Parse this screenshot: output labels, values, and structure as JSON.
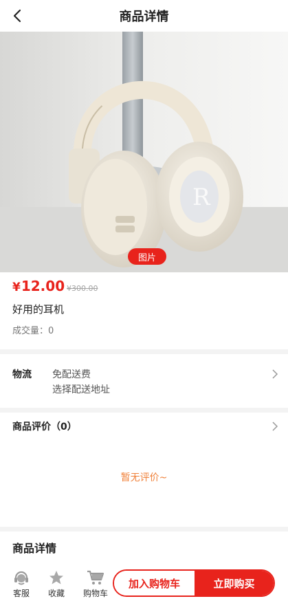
{
  "header": {
    "title": "商品详情"
  },
  "gallery": {
    "tag": "图片"
  },
  "product": {
    "currency": "¥",
    "price": "12.00",
    "original_price": "¥300.00",
    "name": "好用的耳机",
    "sold": "成交量：0"
  },
  "shipping": {
    "label": "物流",
    "line1": "免配送费",
    "line2": "选择配送地址"
  },
  "reviews": {
    "title": "商品评价（0）",
    "empty": "暂无评价~"
  },
  "details": {
    "title": "商品详情"
  },
  "bottom": {
    "service": "客服",
    "favorite": "收藏",
    "cart": "购物车",
    "add_to_cart": "加入购物车",
    "buy_now": "立即购买"
  },
  "icons": {
    "back": "back-arrow-icon",
    "chevron": "chevron-right-icon",
    "service": "headset-icon",
    "favorite": "star-icon",
    "cart": "cart-icon"
  },
  "colors": {
    "accent": "#e8231c",
    "empty_text": "#f0813a"
  }
}
